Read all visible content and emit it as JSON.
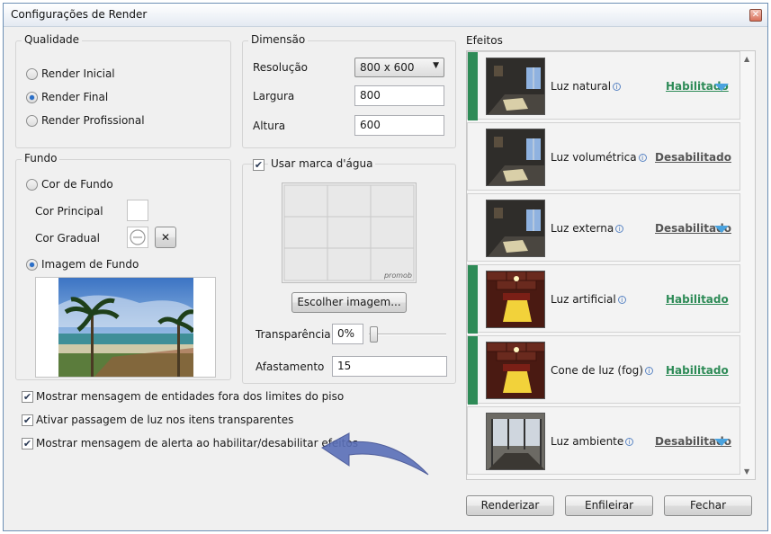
{
  "window": {
    "title": "Configurações de Render",
    "close_glyph": "✕"
  },
  "quality": {
    "legend": "Qualidade",
    "options": [
      "Render Inicial",
      "Render Final",
      "Render Profissional"
    ],
    "selected": "Render Final"
  },
  "dimension": {
    "legend": "Dimensão",
    "resolution_label": "Resolução",
    "resolution_value": "800 x 600",
    "width_label": "Largura",
    "width_value": "800",
    "height_label": "Altura",
    "height_value": "600"
  },
  "background": {
    "legend": "Fundo",
    "color_option": "Cor de Fundo",
    "primary_color_label": "Cor Principal",
    "gradient_color_label": "Cor Gradual",
    "image_option": "Imagem de Fundo",
    "selected": "Imagem de Fundo",
    "clear_glyph": "✕"
  },
  "watermark": {
    "checkbox_label": "Usar marca d'água",
    "checked": true,
    "preview_text": "promob",
    "choose_button": "Escolher imagem...",
    "transparency_label": "Transparência",
    "transparency_value": "0%",
    "offset_label": "Afastamento",
    "offset_value": "15"
  },
  "options": [
    {
      "label": "Mostrar mensagem de entidades fora dos limites do piso",
      "checked": true
    },
    {
      "label": "Ativar passagem de luz nos itens transparentes",
      "checked": true
    },
    {
      "label": "Mostrar mensagem de alerta ao habilitar/desabilitar efeitos",
      "checked": true
    }
  ],
  "effects": {
    "title": "Efeitos",
    "items": [
      {
        "name": "Luz natural",
        "status": "Habilitado",
        "enabled": true,
        "expandable": true
      },
      {
        "name": "Luz volumétrica",
        "status": "Desabilitado",
        "enabled": false,
        "expandable": false
      },
      {
        "name": "Luz externa",
        "status": "Desabilitado",
        "enabled": false,
        "expandable": true
      },
      {
        "name": "Luz artificial",
        "status": "Habilitado",
        "enabled": true,
        "expandable": false
      },
      {
        "name": "Cone de luz (fog)",
        "status": "Habilitado",
        "enabled": true,
        "expandable": false
      },
      {
        "name": "Luz ambiente",
        "status": "Desabilitado",
        "enabled": false,
        "expandable": true
      }
    ]
  },
  "buttons": {
    "render": "Renderizar",
    "queue": "Enfileirar",
    "close": "Fechar"
  },
  "colors": {
    "enabled_green": "#2e8b57",
    "accent_blue": "#4aa3df",
    "arrow_blue": "#5a6fb8"
  }
}
